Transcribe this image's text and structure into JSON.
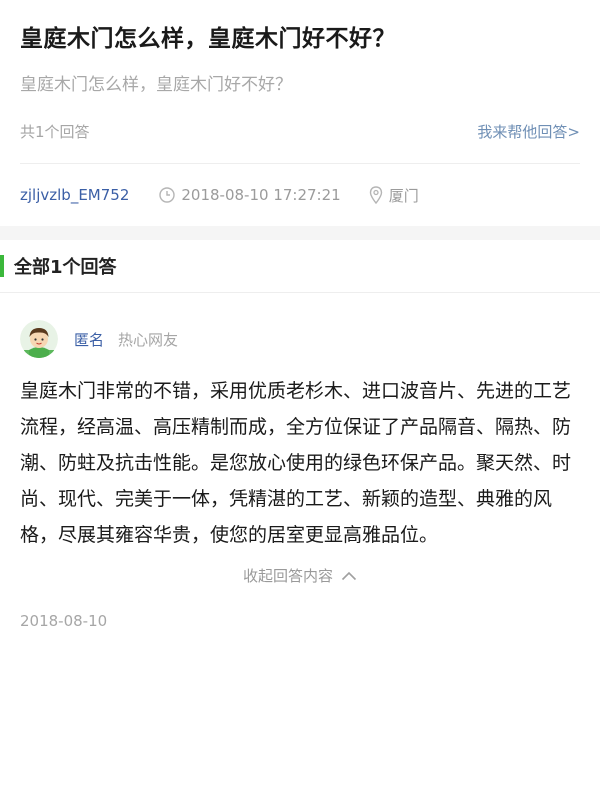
{
  "question": {
    "title": "皇庭木门怎么样，皇庭木门好不好？",
    "description": "皇庭木门怎么样，皇庭木门好不好？",
    "answer_count_label": "共1个回答",
    "help_link": "我来帮他回答>",
    "author": "zjljvzlb_EM752",
    "time": "2018-08-10 17:27:21",
    "location": "厦门",
    "icons": [
      "clock-icon",
      "location-pin-icon"
    ]
  },
  "answers_section": {
    "header": "全部1个回答",
    "accent_color": "#3bb83b"
  },
  "answer": {
    "user_name": "匿名",
    "user_role": "热心网友",
    "content": "皇庭木门非常的不错，采用优质老杉木、进口波音片、先进的工艺流程，经高温、高压精制而成，全方位保证了产品隔音、隔热、防潮、防蛀及抗击性能。是您放心使用的绿色环保产品。聚天然、时尚、现代、完美于一体，凭精湛的工艺、新颖的造型、典雅的风格，尽展其雍容华贵，使您的居室更显高雅品位。",
    "collapse_label": "收起回答内容",
    "date": "2018-08-10",
    "icons": [
      "avatar-icon",
      "chevron-up-icon"
    ]
  }
}
